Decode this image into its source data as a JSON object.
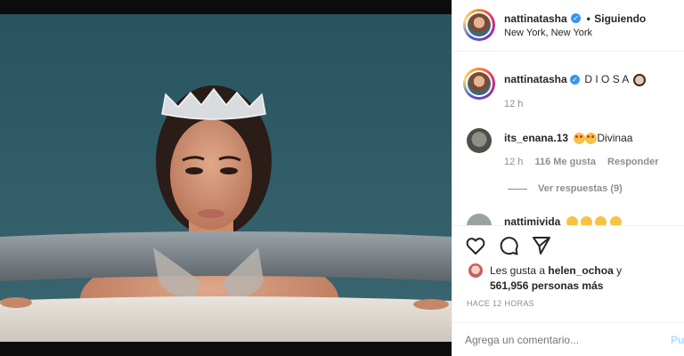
{
  "header": {
    "username": "nattinatasha",
    "separator": "•",
    "follow_status": "Siguiendo",
    "location": "New York, New York"
  },
  "caption": {
    "username": "nattinatasha",
    "text": "D I O S A",
    "time": "12 h"
  },
  "comments": [
    {
      "username": "its_enana.13",
      "text": "Divinaa",
      "time": "12 h",
      "likes": "116 Me gusta",
      "reply_label": "Responder",
      "view_replies": "Ver respuestas (9)"
    },
    {
      "username": "nattimivida"
    }
  ],
  "likes": {
    "prefix": "Les gusta a",
    "user": "helen_ochoa",
    "conjunction": "y",
    "count_text": "561,956 personas más"
  },
  "timestamp": "HACE 12 HORAS",
  "add_comment": {
    "placeholder": "Agrega un comentario...",
    "post_label": "Pu"
  },
  "icons": {
    "heart": "heart-icon",
    "comment": "comment-icon",
    "share": "share-icon",
    "verified": "verified-badge-icon"
  },
  "colors": {
    "accent": "#3897f0",
    "muted": "#8e8e8e",
    "text": "#262626"
  }
}
